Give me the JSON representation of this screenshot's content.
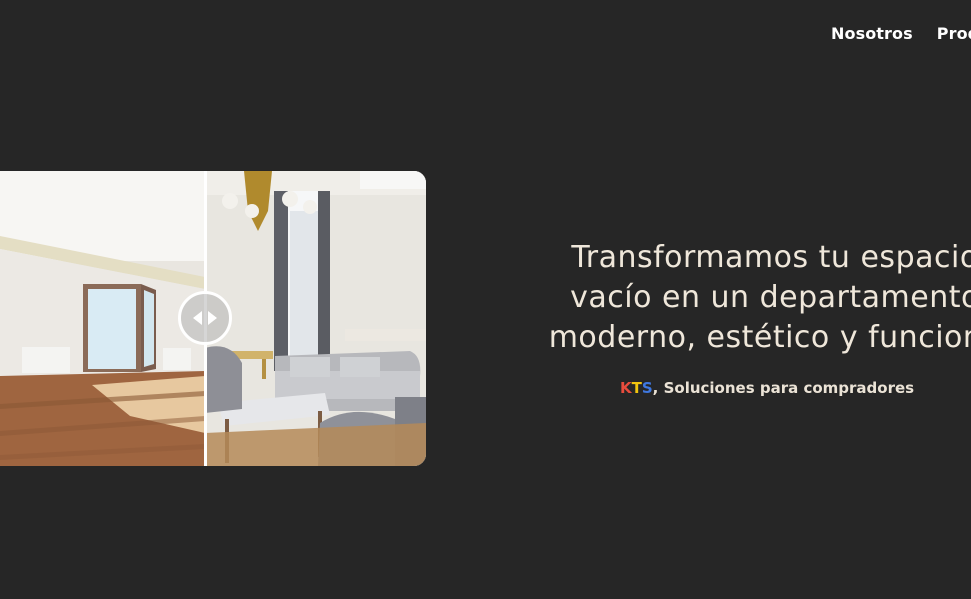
{
  "nav": {
    "items": [
      {
        "label": "Nosotros"
      },
      {
        "label": "Produ"
      }
    ]
  },
  "hero": {
    "title_lines": [
      "Transformamos tu espacio",
      "vacío en un departamento",
      "moderno, estético y funciona"
    ],
    "subtitle": {
      "brand_letters": [
        "K",
        "T",
        "S"
      ],
      "suffix": ", Soluciones para compradores"
    }
  },
  "colors": {
    "background": "#262626",
    "text_primary": "#efe7da",
    "brand_k": "#e84c3d",
    "brand_t": "#f1c40f",
    "brand_s": "#3f78e0"
  },
  "icons": {
    "handle": "left-right-arrows-icon"
  }
}
